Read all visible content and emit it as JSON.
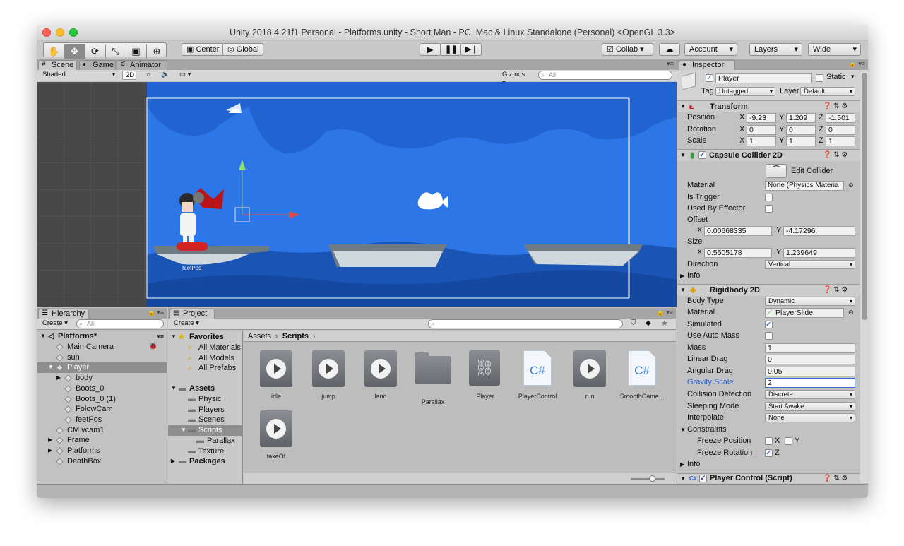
{
  "window": {
    "title": "Unity 2018.4.21f1 Personal - Platforms.unity - Short Man - PC, Mac & Linux Standalone (Personal) <OpenGL 3.3>"
  },
  "toolbar": {
    "center": "Center",
    "global": "Global",
    "collab": "Collab",
    "account": "Account",
    "layers": "Layers",
    "layout": "Wide"
  },
  "scene": {
    "tabs": [
      "Scene",
      "Game",
      "Animator"
    ],
    "shading": "Shaded",
    "mode2d": "2D",
    "gizmos": "Gizmos",
    "search_placeholder": "All",
    "feet_label": "feetPos"
  },
  "hierarchy": {
    "tab": "Hierarchy",
    "create": "Create",
    "search_placeholder": "All",
    "root": "Platforms*",
    "items": [
      {
        "label": "Main Camera",
        "depth": 1
      },
      {
        "label": "sun",
        "depth": 1
      },
      {
        "label": "Player",
        "depth": 1,
        "selected": true
      },
      {
        "label": "body",
        "depth": 2
      },
      {
        "label": "Boots_0",
        "depth": 2
      },
      {
        "label": "Boots_0 (1)",
        "depth": 2
      },
      {
        "label": "FolowCam",
        "depth": 2
      },
      {
        "label": "feetPos",
        "depth": 2
      },
      {
        "label": "CM vcam1",
        "depth": 1
      },
      {
        "label": "Frame",
        "depth": 1
      },
      {
        "label": "Platforms",
        "depth": 1
      },
      {
        "label": "DeathBox",
        "depth": 1
      }
    ]
  },
  "project": {
    "tab": "Project",
    "create": "Create",
    "favorites": "Favorites",
    "fav_items": [
      "All Materials",
      "All Models",
      "All Prefabs"
    ],
    "assets_label": "Assets",
    "asset_folders": [
      "Physic",
      "Players",
      "Scenes",
      "Scripts",
      "Parallax",
      "Texture"
    ],
    "packages": "Packages",
    "breadcrumb": [
      "Assets",
      "Scripts"
    ],
    "files": [
      {
        "name": "idle",
        "kind": "anim"
      },
      {
        "name": "jump",
        "kind": "anim"
      },
      {
        "name": "land",
        "kind": "anim"
      },
      {
        "name": "Parallax",
        "kind": "folder"
      },
      {
        "name": "Player",
        "kind": "controller"
      },
      {
        "name": "PlayerControl",
        "kind": "cs"
      },
      {
        "name": "run",
        "kind": "anim"
      },
      {
        "name": "SmoothCame...",
        "kind": "cs"
      },
      {
        "name": "takeOf",
        "kind": "anim"
      }
    ]
  },
  "inspector": {
    "tab": "Inspector",
    "object_name": "Player",
    "static": "Static",
    "tag_label": "Tag",
    "tag": "Untagged",
    "layer_label": "Layer",
    "layer": "Default",
    "transform": {
      "title": "Transform",
      "position_label": "Position",
      "rotation_label": "Rotation",
      "scale_label": "Scale",
      "position": [
        "-9.23",
        "1.209",
        "-1.501"
      ],
      "rotation": [
        "0",
        "0",
        "0"
      ],
      "scale": [
        "1",
        "1",
        "1"
      ]
    },
    "collider": {
      "title": "Capsule Collider 2D",
      "edit": "Edit Collider",
      "material_label": "Material",
      "material": "None (Physics Materia",
      "is_trigger": "Is Trigger",
      "used_by_effector": "Used By Effector",
      "offset_label": "Offset",
      "offset": [
        "0.00668335",
        "-4.17296"
      ],
      "size_label": "Size",
      "size": [
        "0.5505178",
        "1.239649"
      ],
      "direction_label": "Direction",
      "direction": "Vertical",
      "info": "Info"
    },
    "rigidbody": {
      "title": "Rigidbody 2D",
      "body_type_label": "Body Type",
      "body_type": "Dynamic",
      "material_label": "Material",
      "material": "PlayerSlide",
      "simulated": "Simulated",
      "use_auto_mass": "Use Auto Mass",
      "mass_label": "Mass",
      "mass": "1",
      "linear_drag_label": "Linear Drag",
      "linear_drag": "0",
      "angular_drag_label": "Angular Drag",
      "angular_drag": "0.05",
      "gravity_label": "Gravity Scale",
      "gravity": "2",
      "collision_label": "Collision Detection",
      "collision": "Discrete",
      "sleeping_label": "Sleeping Mode",
      "sleeping": "Start Awake",
      "interpolate_label": "Interpolate",
      "interpolate": "None",
      "constraints": "Constraints",
      "freeze_pos": "Freeze Position",
      "freeze_rot": "Freeze Rotation",
      "info": "Info"
    },
    "script": {
      "title": "Player Control (Script)"
    }
  }
}
